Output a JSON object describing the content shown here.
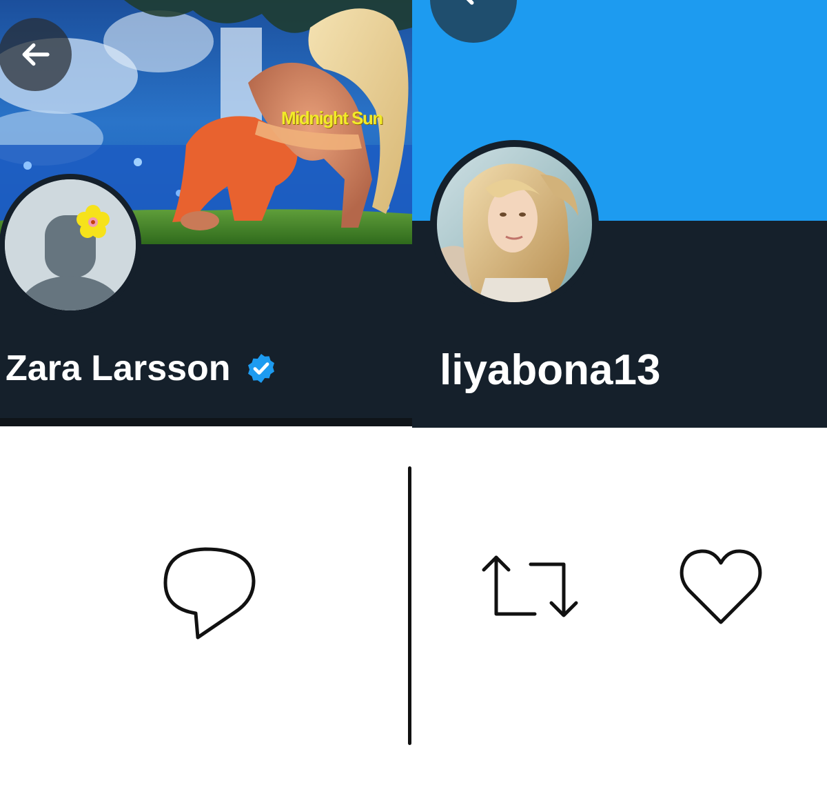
{
  "left_profile": {
    "banner_text": "Midnight Sun",
    "display_name": "Zara Larsson",
    "verified": true,
    "back_icon": "arrow-left-icon",
    "avatar": "default-avatar-with-flower"
  },
  "right_profile": {
    "handle": "liyabona13",
    "back_icon": "arrow-left-icon",
    "avatar": "profile-photo"
  },
  "actions": [
    {
      "icon": "reply-icon"
    },
    {
      "icon": "retweet-icon"
    },
    {
      "icon": "like-icon"
    }
  ],
  "colors": {
    "dark_background": "#15202b",
    "banner_blue": "#1d9bf0",
    "verified_blue": "#1d9bf0",
    "banner_text_yellow": "#f2ea2a",
    "icon_stroke": "#111111"
  }
}
